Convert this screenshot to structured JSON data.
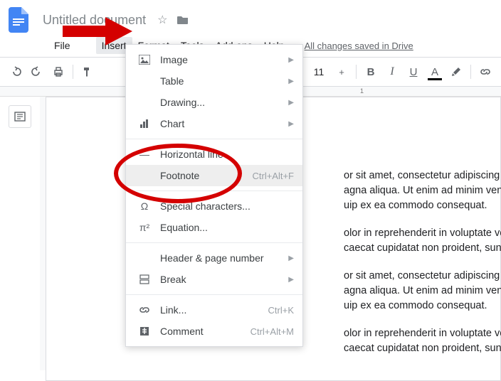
{
  "header": {
    "title": "Untitled document"
  },
  "menubar": {
    "items": [
      "File",
      "",
      "Insert",
      "Format",
      "Tools",
      "Add-ons",
      "Help"
    ],
    "save_status": "All changes saved in Drive"
  },
  "toolbar": {
    "font_size": "11",
    "bold": "B",
    "italic": "I",
    "underline": "U",
    "text_color": "A"
  },
  "ruler": {
    "marks": [
      "1"
    ]
  },
  "dropdown": {
    "items": [
      {
        "label": "Image",
        "arrow": true
      },
      {
        "label": "Table",
        "arrow": true
      },
      {
        "label": "Drawing...",
        "arrow": true
      },
      {
        "label": "Chart",
        "arrow": true
      },
      {
        "sep": true
      },
      {
        "label": "Horizontal line"
      },
      {
        "label": "Footnote",
        "shortcut": "Ctrl+Alt+F",
        "highlighted": true
      },
      {
        "sep": true
      },
      {
        "label": "Special characters..."
      },
      {
        "label": "Equation..."
      },
      {
        "sep": true
      },
      {
        "label": "Header & page number",
        "arrow": true
      },
      {
        "label": "Break",
        "arrow": true
      },
      {
        "sep": true
      },
      {
        "label": "Link...",
        "shortcut": "Ctrl+K"
      },
      {
        "label": "Comment",
        "shortcut": "Ctrl+Alt+M"
      }
    ]
  },
  "document": {
    "paragraphs": [
      "or sit amet, consectetur adipiscing elit, sed d",
      "agna aliqua. Ut enim ad minim veniam, qu",
      "uip ex ea commodo consequat.",
      "olor in reprehenderit in voluptate velit esse c",
      "caecat cupidatat non proident, sunt in culpa",
      "or sit amet, consectetur adipiscing elit, sed d",
      "agna aliqua. Ut enim ad minim veniam, qu",
      "uip ex ea commodo consequat.",
      "olor in reprehenderit in voluptate velit esse c",
      "caecat cupidatat non proident, sunt in culpa"
    ]
  }
}
